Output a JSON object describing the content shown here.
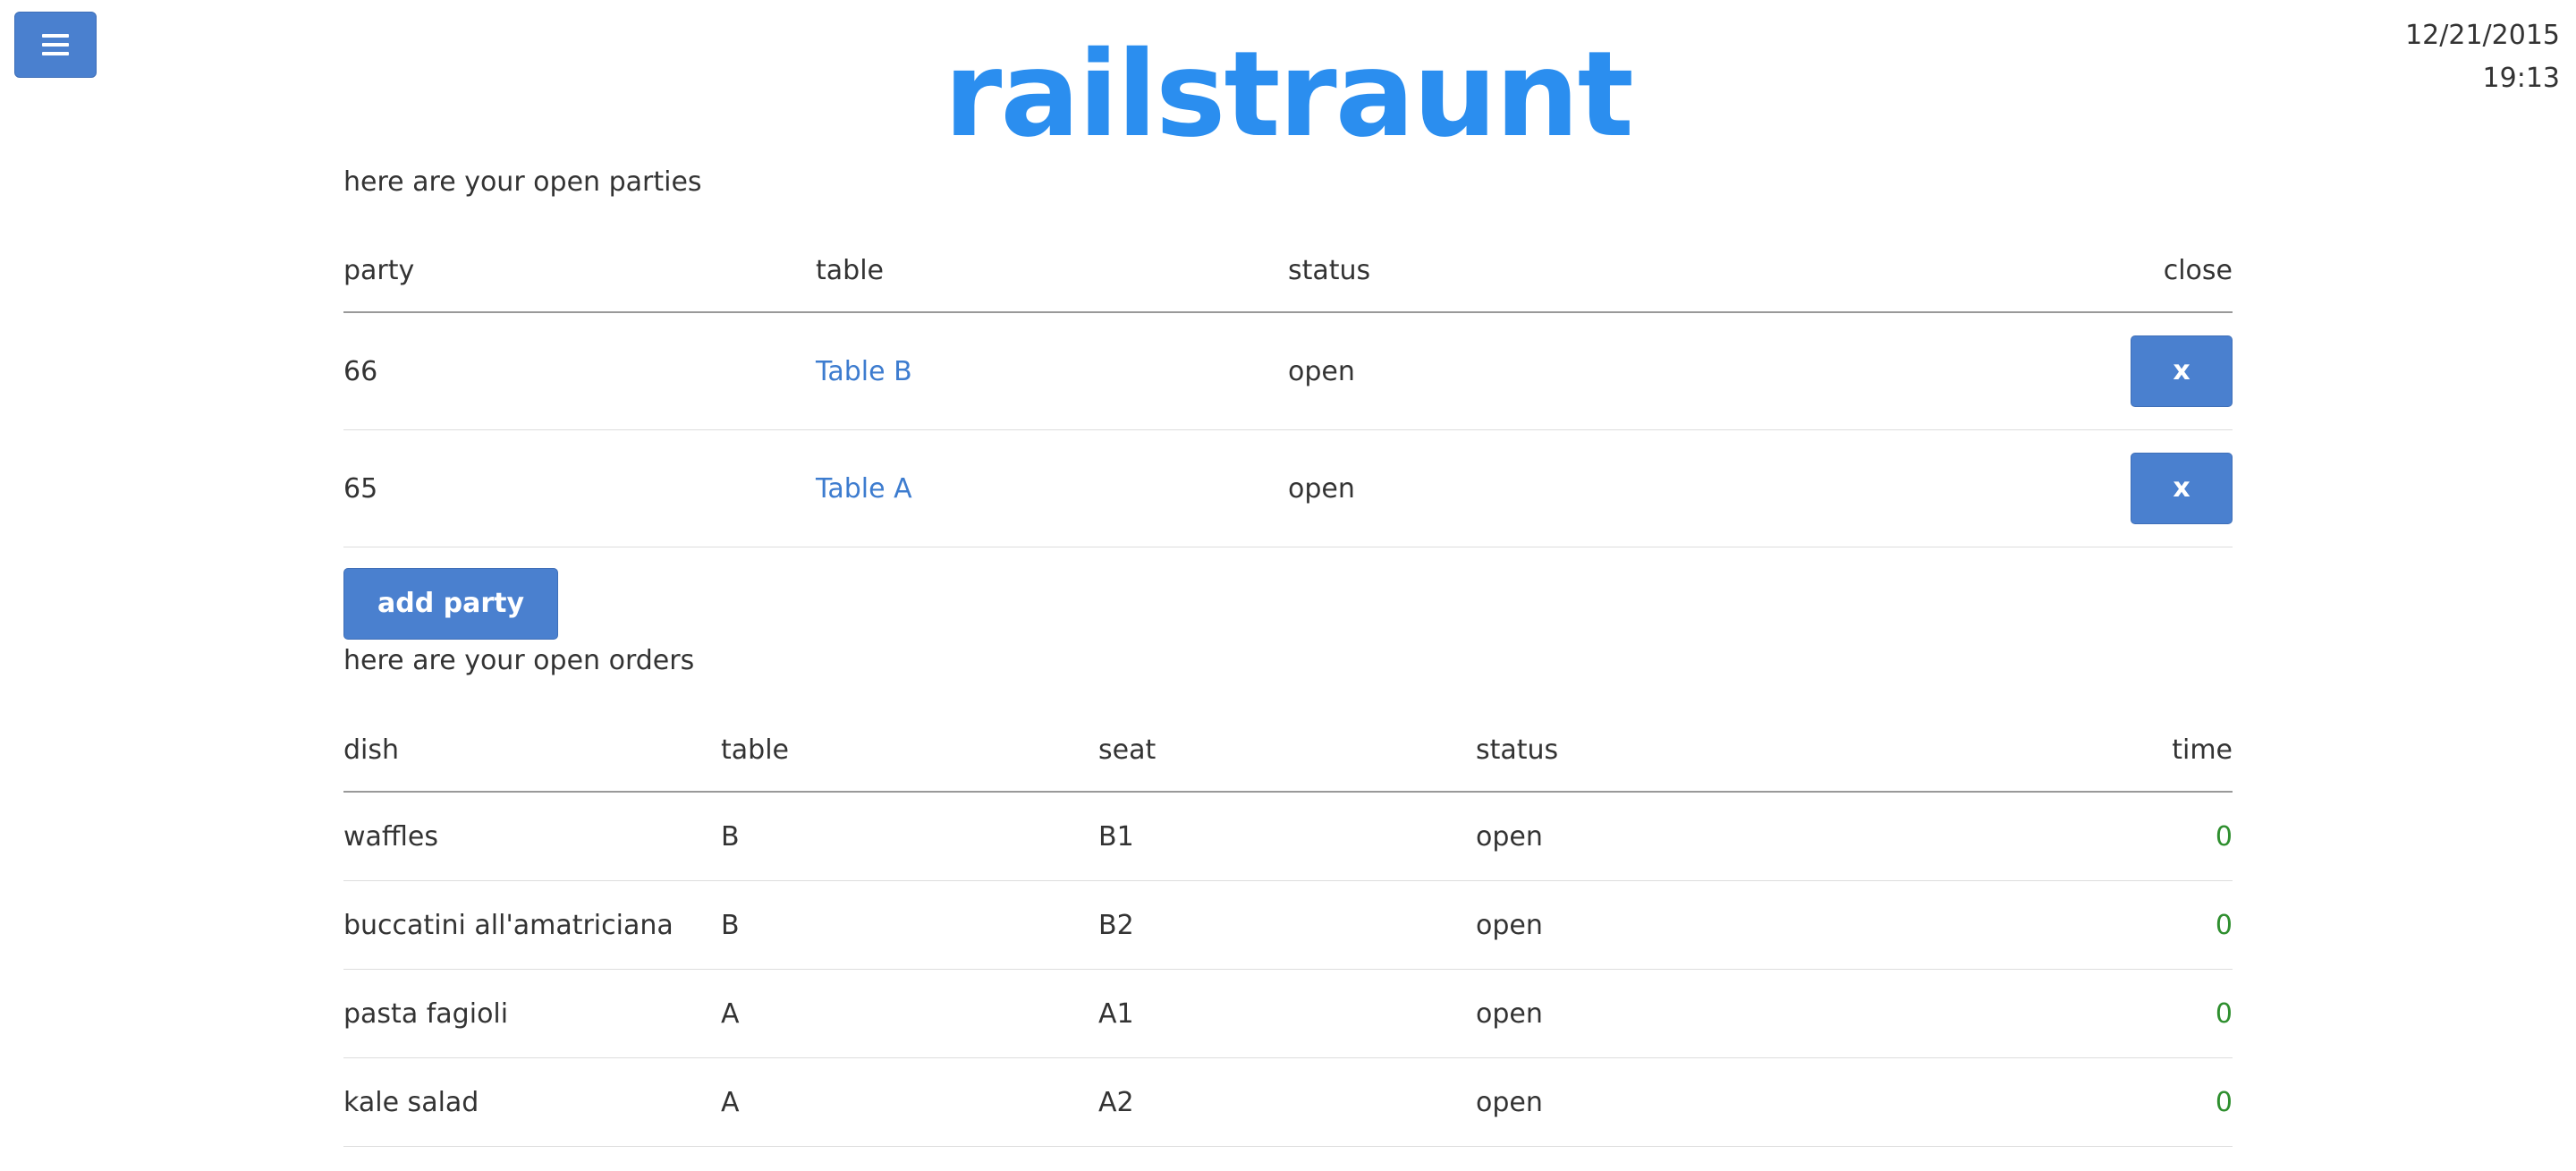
{
  "header": {
    "menu_icon": "hamburger-menu-icon",
    "brand": "railstraunt",
    "date": "12/21/2015",
    "time": "19:13"
  },
  "colors": {
    "brand": "#2b8eef",
    "button": "#4a80cf",
    "link": "#3d7ccf",
    "time_ok": "#2f8f2f"
  },
  "parties": {
    "caption": "here are your open parties",
    "columns": [
      "party",
      "table",
      "status",
      "close"
    ],
    "rows": [
      {
        "party": "66",
        "table": "Table B",
        "status": "open",
        "close": "x"
      },
      {
        "party": "65",
        "table": "Table A",
        "status": "open",
        "close": "x"
      }
    ],
    "add_label": "add party"
  },
  "orders": {
    "caption": "here are your open orders",
    "columns": [
      "dish",
      "table",
      "seat",
      "status",
      "time"
    ],
    "rows": [
      {
        "dish": "waffles",
        "table": "B",
        "seat": "B1",
        "status": "open",
        "time": "0"
      },
      {
        "dish": "buccatini all'amatriciana",
        "table": "B",
        "seat": "B2",
        "status": "open",
        "time": "0"
      },
      {
        "dish": "pasta fagioli",
        "table": "A",
        "seat": "A1",
        "status": "open",
        "time": "0"
      },
      {
        "dish": "kale salad",
        "table": "A",
        "seat": "A2",
        "status": "open",
        "time": "0"
      }
    ]
  }
}
